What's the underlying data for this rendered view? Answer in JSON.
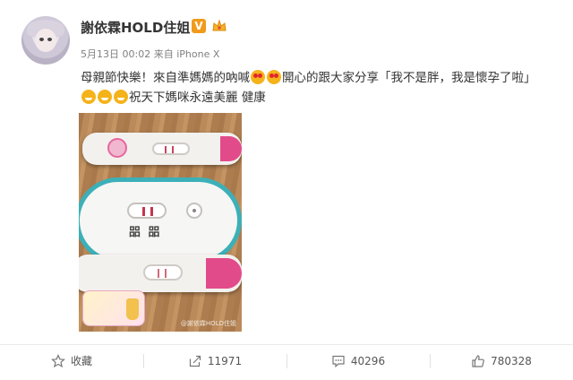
{
  "post": {
    "username": "謝依霖HOLD住姐",
    "badge_letter": "V",
    "date": "5月13日 00:02",
    "source_prefix": "来自",
    "source_device": "iPhone X",
    "text": {
      "part1": "母親節快樂！來自準媽媽的吶喊",
      "part2": "開心的跟大家分享「我不是胖，我是懷孕了啦」",
      "part3": "祝天下媽咪永遠美麗 健康"
    },
    "photo": {
      "test_label": "㗊 㗊",
      "watermark": "@謝依霖HOLD住姐",
      "icons": [
        "pregnancy-test-image",
        "mothers-day-sticker"
      ]
    }
  },
  "actions": {
    "favorite_label": "收藏",
    "repost_count": "11971",
    "comment_count": "40296",
    "like_count": "780328"
  },
  "colors": {
    "badge": "#f19a1b",
    "test_cap": "#e24b8a",
    "test_rim": "#3cb0b8"
  }
}
